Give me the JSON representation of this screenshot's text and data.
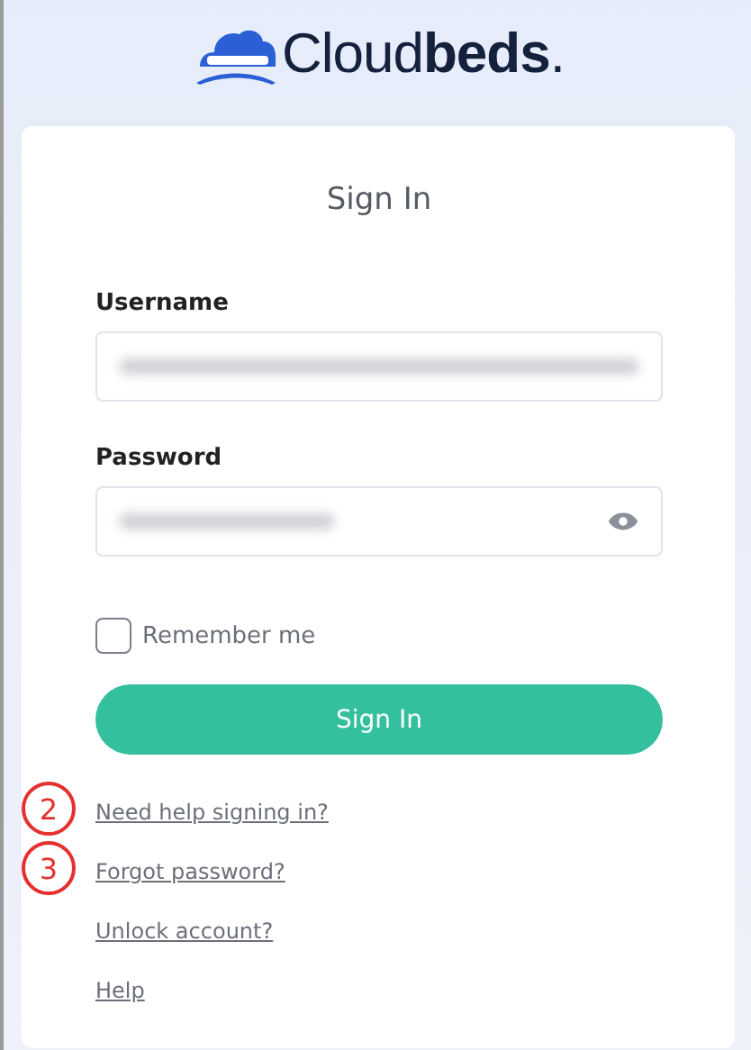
{
  "logo": {
    "text": "Cloud**beds**."
  },
  "form": {
    "title": "Sign In",
    "fields": [
      {
        "label": "Username",
        "kind": "text",
        "blurred": true
      },
      {
        "label": "Password",
        "kind": "password",
        "blurred": true
      }
    ],
    "remember": {
      "label": "Remember me",
      "checked": false
    },
    "submit": "Sign In"
  },
  "links": [
    {
      "label": "Need help signing in?",
      "callout": "2"
    },
    {
      "label": "Forgot password?",
      "callout": "3"
    },
    {
      "label": "Unlock account?"
    },
    {
      "label": "Help"
    }
  ]
}
